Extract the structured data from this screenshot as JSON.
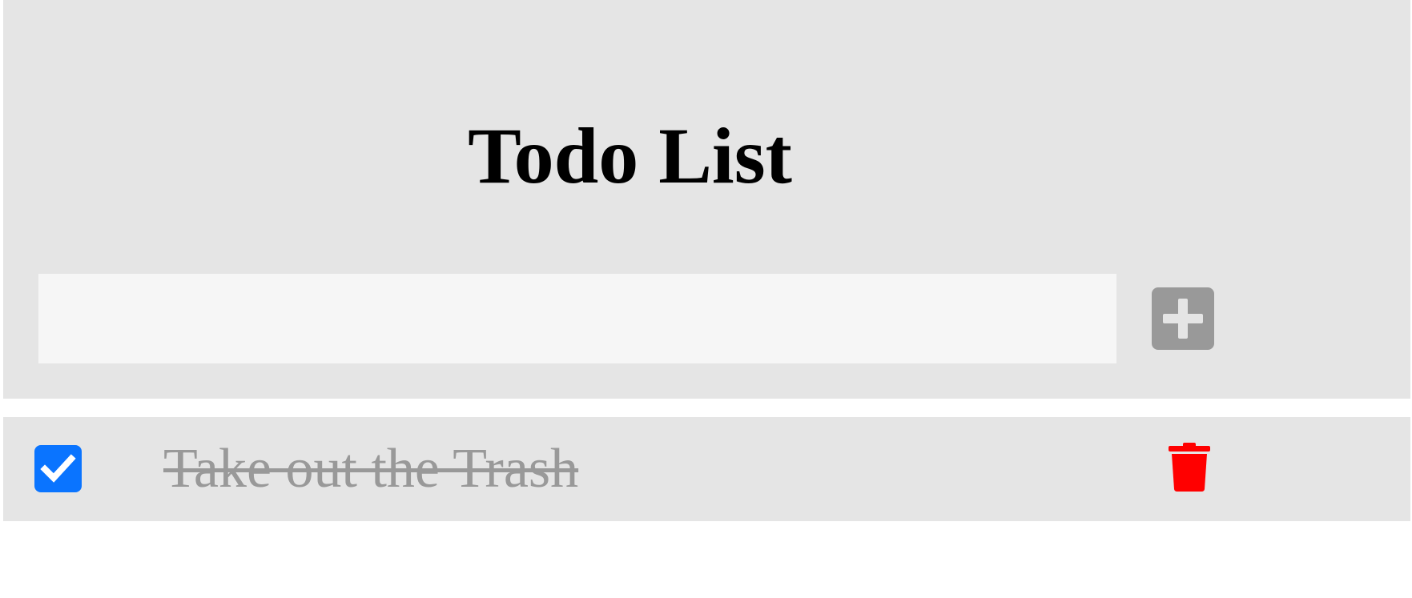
{
  "header": {
    "title": "Todo List",
    "input": {
      "value": "",
      "placeholder": ""
    },
    "add_button": {
      "icon": "plus-icon"
    }
  },
  "todos": [
    {
      "text": "Take out the Trash",
      "completed": true,
      "checkbox_icon": "checkmark-icon",
      "delete_icon": "trash-icon"
    }
  ],
  "colors": {
    "header_bg": "#e5e5e5",
    "input_bg": "#f6f6f6",
    "add_button_bg": "#999999",
    "checkbox_bg": "#0a74ff",
    "completed_text": "#999999",
    "delete_icon": "#ff0000"
  }
}
